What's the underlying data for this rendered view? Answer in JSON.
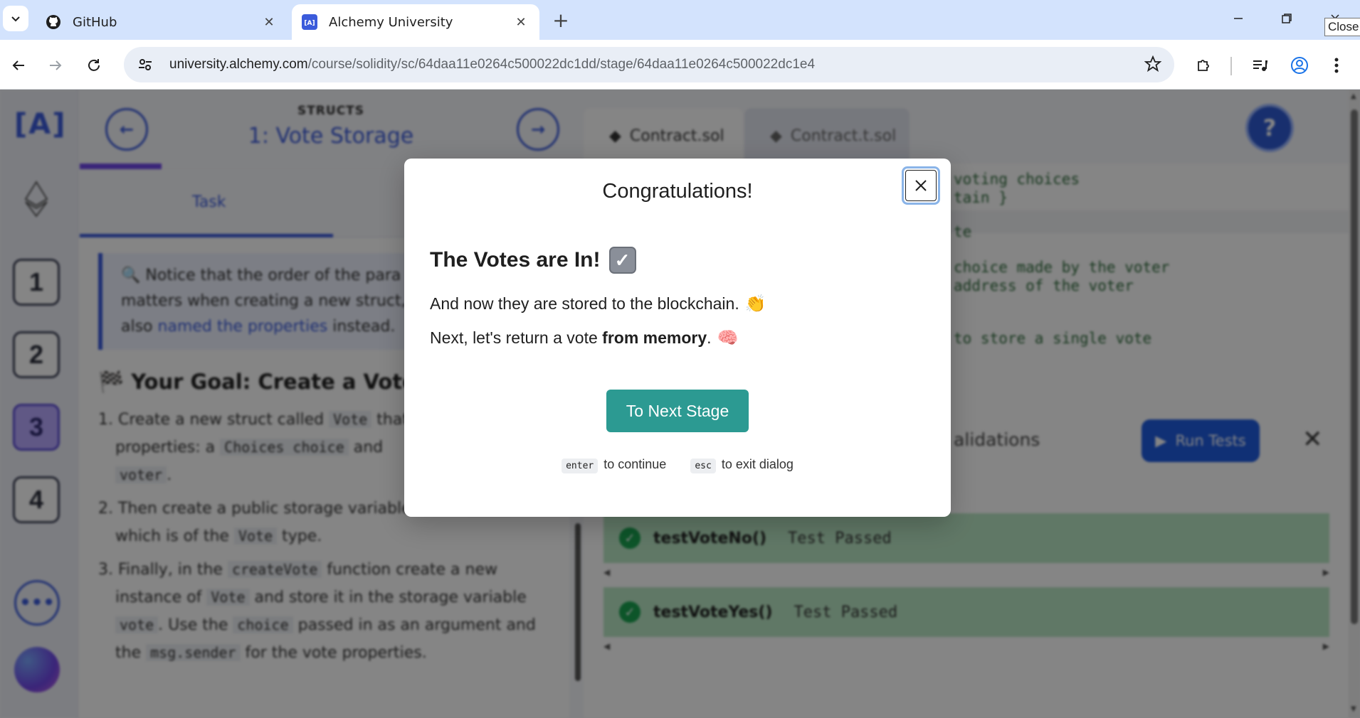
{
  "browser": {
    "tabs": [
      {
        "title": "GitHub",
        "icon": "github-icon",
        "active": false
      },
      {
        "title": "Alchemy University",
        "icon": "alchemy-favicon",
        "active": true
      }
    ],
    "url_host": "university.alchemy.com",
    "url_path": "/course/solidity/sc/64daa11e0264c500022dc1dd/stage/64daa11e0264c500022dc1e4",
    "close_tooltip": "Close"
  },
  "app": {
    "logo": "[A]",
    "stages": [
      "1",
      "2",
      "3",
      "4"
    ],
    "current_stage": "3",
    "more_label": "•••",
    "lesson_kicker": "STRUCTS",
    "lesson_title": "1: Vote Storage",
    "task_tab": "Task",
    "note_text_1": "🔍 Notice that the order of the para",
    "note_text_2": "matters when creating a new struct,",
    "note_text_3_prefix": "also ",
    "note_link": "named the properties",
    "note_text_3_suffix": " instead.",
    "goal_title": "🏁 Your Goal: Create a Vote",
    "steps": {
      "s1_a": "1. Create a new struct called ",
      "s1_code1": "Vote",
      "s1_b": " that",
      "s1_c": "properties: a ",
      "s1_code2": "Choices choice",
      "s1_d": " and",
      "s1_code3": "voter",
      "s1_e": ".",
      "s2_a": "2. Then create a public storage variable called ",
      "s2_code1": "vote",
      "s2_b": "which is of the ",
      "s2_code2": "Vote",
      "s2_c": " type.",
      "s3_a": "3. Finally, in the ",
      "s3_code1": "createVote",
      "s3_b": " function create a new",
      "s3_c": "instance of ",
      "s3_code2": "Vote",
      "s3_d": " and store it in the storage variable",
      "s3_code3": "vote",
      "s3_e": ". Use the ",
      "s3_code4": "choice",
      "s3_f": " passed in as an argument and",
      "s3_g": "the ",
      "s3_code5": "msg.sender",
      "s3_h": " for the vote properties."
    },
    "file_tabs": [
      "Contract.sol",
      "Contract.t.sol"
    ],
    "help_label": "?",
    "code_lines": [
      "voting choices",
      "tain }",
      "te",
      "choice made by the voter",
      "address of the voter",
      "to store a single vote"
    ],
    "validations_label": "alidations",
    "run_tests_label": "Run Tests",
    "results": [
      {
        "name": "testVoteNo()",
        "status": "Test Passed"
      },
      {
        "name": "testVoteYes()",
        "status": "Test Passed"
      }
    ]
  },
  "modal": {
    "title": "Congratulations!",
    "heading": "The Votes are In!",
    "line1_text": "And now they are stored to the blockchain.",
    "line1_emoji": "👏",
    "line2_prefix": "Next, let's return a vote ",
    "line2_bold": "from memory",
    "line2_suffix": ".",
    "line2_emoji": "🧠",
    "cta_label": "To Next Stage",
    "hint_enter_key": "enter",
    "hint_enter_text": "to continue",
    "hint_esc_key": "esc",
    "hint_esc_text": "to exit dialog"
  }
}
